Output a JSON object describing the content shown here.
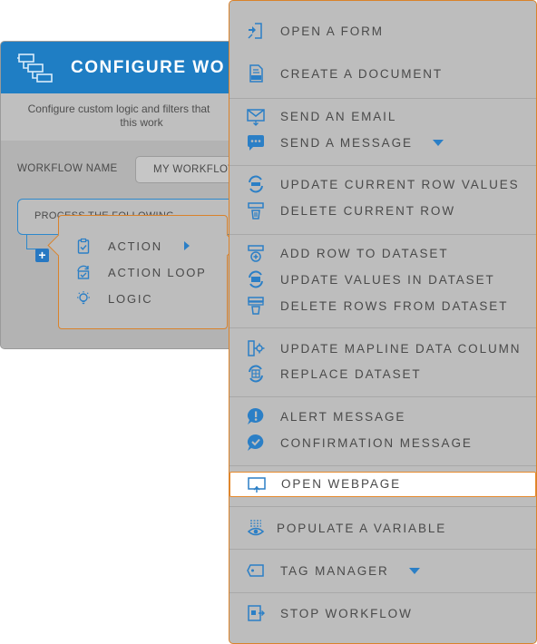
{
  "dialog": {
    "title": "CONFIGURE WO",
    "description_line1": "Configure custom logic and filters that",
    "description_line2": "this work",
    "workflow_name_label": "WORKFLOW NAME",
    "workflow_name_value": "MY WORKFLOW",
    "process_label": "PROCESS THE FOLLOWING",
    "add_symbol": "+"
  },
  "popup": {
    "items": [
      {
        "label": "ACTION",
        "icon": "clipboard-check-icon",
        "has_submenu": true
      },
      {
        "label": "ACTION LOOP",
        "icon": "loop-check-icon"
      },
      {
        "label": "LOGIC",
        "icon": "logic-bulb-icon"
      }
    ]
  },
  "menu": {
    "items": [
      {
        "label": "OPEN A FORM",
        "icon": "form-icon"
      },
      {
        "label": "CREATE A DOCUMENT",
        "icon": "pdf-document-icon"
      },
      {
        "label": "SEND AN EMAIL",
        "icon": "email-icon"
      },
      {
        "label": "SEND A MESSAGE",
        "icon": "chat-bubble-icon",
        "dropdown": true
      },
      {
        "label": "UPDATE CURRENT ROW VALUES",
        "icon": "row-refresh-icon"
      },
      {
        "label": "DELETE CURRENT ROW",
        "icon": "row-delete-icon"
      },
      {
        "label": "ADD ROW TO DATASET",
        "icon": "row-add-icon"
      },
      {
        "label": "UPDATE VALUES IN DATASET",
        "icon": "dataset-refresh-icon"
      },
      {
        "label": "DELETE ROWS FROM DATASET",
        "icon": "dataset-delete-icon"
      },
      {
        "label": "UPDATE MAPLINE DATA COLUMN",
        "icon": "column-gear-icon"
      },
      {
        "label": "REPLACE DATASET",
        "icon": "dataset-replace-icon"
      },
      {
        "label": "ALERT MESSAGE",
        "icon": "alert-bubble-icon"
      },
      {
        "label": "CONFIRMATION MESSAGE",
        "icon": "confirm-bubble-icon"
      },
      {
        "label": "OPEN WEBPAGE",
        "icon": "monitor-icon",
        "highlighted": true
      },
      {
        "label": "POPULATE A VARIABLE",
        "icon": "variable-eye-icon"
      },
      {
        "label": "TAG MANAGER",
        "icon": "tag-icon",
        "dropdown": true
      },
      {
        "label": "STOP WORKFLOW",
        "icon": "stop-workflow-icon"
      }
    ]
  },
  "colors": {
    "accent_blue": "#1f7ec4",
    "highlight_orange": "#e68a2e",
    "overlay_gray": "#bdbdbd",
    "text_gray": "#4a4a4a"
  }
}
